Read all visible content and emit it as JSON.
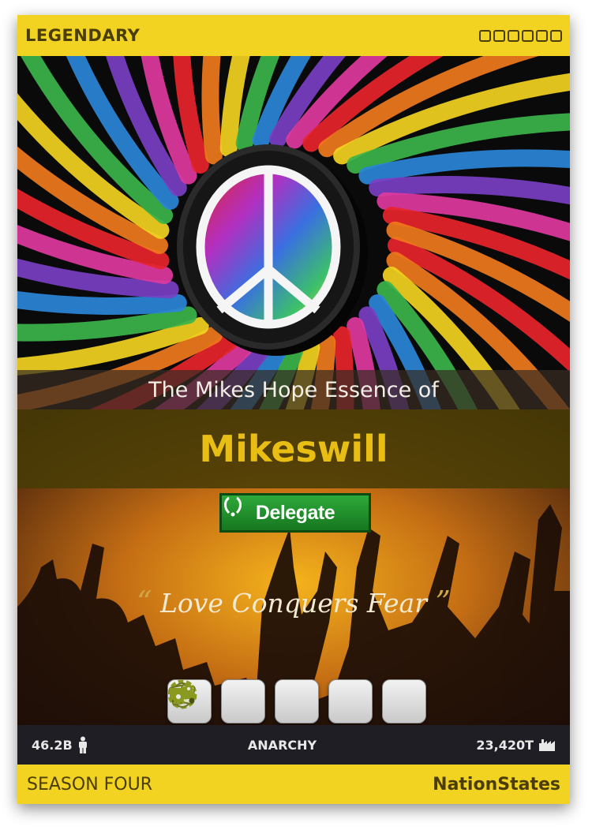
{
  "card": {
    "rarity": "LEGENDARY",
    "stars": [
      "",
      "",
      "",
      "",
      "",
      ""
    ],
    "pretitle": "The Mikes Hope Essence of",
    "name": "Mikeswill",
    "badge": {
      "label": "Delegate",
      "icon": "laurel-icon"
    },
    "motto": "Love Conquers Fear",
    "motto_open_quote": "“",
    "motto_close_quote": "”",
    "action_icons": [
      "life-ring-icon",
      "easter-egg-icon",
      "trading-cards-icon",
      "truck-icon",
      "gears-icon"
    ],
    "stats": {
      "population": "46.2B",
      "government": "ANARCHY",
      "economy": "23,420T"
    },
    "season": "SEASON FOUR",
    "brand": "NationStates"
  },
  "colors": {
    "accent_yellow": "#f2d321",
    "name_gold": "#e8be14",
    "delegate_green": "#1f9a2a",
    "stat_bar": "#1e1e24"
  }
}
